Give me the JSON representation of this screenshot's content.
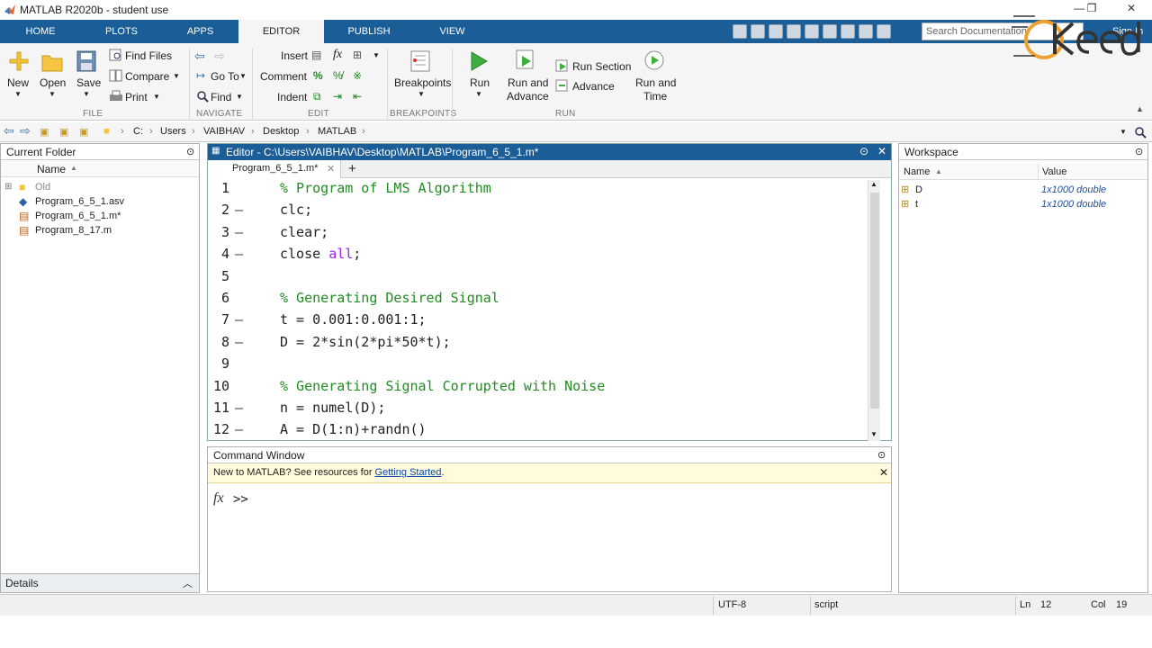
{
  "window": {
    "title": "MATLAB R2020b - student use"
  },
  "ribbon_tabs": [
    "HOME",
    "PLOTS",
    "APPS",
    "EDITOR",
    "PUBLISH",
    "VIEW"
  ],
  "search": {
    "placeholder": "Search Documentation"
  },
  "sign_in": "Sign In",
  "ribbon": {
    "file": {
      "new": "New",
      "open": "Open",
      "save": "Save",
      "find_files": "Find Files",
      "compare": "Compare",
      "print": "Print",
      "section": "FILE"
    },
    "navigate": {
      "go_to": "Go To",
      "find": "Find",
      "section": "NAVIGATE"
    },
    "edit": {
      "insert": "Insert",
      "comment": "Comment",
      "indent": "Indent",
      "section": "EDIT"
    },
    "breakpoints": {
      "label": "Breakpoints",
      "section": "BREAKPOINTS"
    },
    "run": {
      "run": "Run",
      "run_and_advance_1": "Run and",
      "run_and_advance_2": "Advance",
      "run_section": "Run Section",
      "advance": "Advance",
      "run_and_time_1": "Run and",
      "run_and_time_2": "Time",
      "section": "RUN"
    }
  },
  "address": {
    "crumbs": [
      "C:",
      "Users",
      "VAIBHAV",
      "Desktop",
      "MATLAB"
    ]
  },
  "current_folder": {
    "title": "Current Folder",
    "column": "Name",
    "items": [
      "Old",
      "Program_6_5_1.asv",
      "Program_6_5_1.m*",
      "Program_8_17.m"
    ]
  },
  "editor": {
    "title": "Editor - C:\\Users\\VAIBHAV\\Desktop\\MATLAB\\Program_6_5_1.m*",
    "tab": "Program_6_5_1.m*",
    "lines": [
      {
        "n": "1",
        "dash": "",
        "segs": [
          [
            "cmt",
            "% Program of LMS Algorithm"
          ]
        ]
      },
      {
        "n": "2",
        "dash": "—",
        "segs": [
          [
            "",
            "clc;"
          ]
        ]
      },
      {
        "n": "3",
        "dash": "—",
        "segs": [
          [
            "",
            "clear;"
          ]
        ]
      },
      {
        "n": "4",
        "dash": "—",
        "segs": [
          [
            "",
            "close "
          ],
          [
            "kw",
            "all"
          ],
          [
            "",
            ";"
          ]
        ]
      },
      {
        "n": "5",
        "dash": "",
        "segs": [
          [
            "",
            ""
          ]
        ]
      },
      {
        "n": "6",
        "dash": "",
        "segs": [
          [
            "cmt",
            "% Generating Desired Signal"
          ]
        ]
      },
      {
        "n": "7",
        "dash": "—",
        "segs": [
          [
            "",
            "t = 0.001:0.001:1;"
          ]
        ]
      },
      {
        "n": "8",
        "dash": "—",
        "segs": [
          [
            "",
            "D = 2*sin(2*pi*50*t);"
          ]
        ]
      },
      {
        "n": "9",
        "dash": "",
        "segs": [
          [
            "",
            ""
          ]
        ]
      },
      {
        "n": "10",
        "dash": "",
        "segs": [
          [
            "cmt",
            "% Generating Signal Corrupted with Noise"
          ]
        ]
      },
      {
        "n": "11",
        "dash": "—",
        "segs": [
          [
            "",
            "n = numel(D);"
          ]
        ]
      },
      {
        "n": "12",
        "dash": "—",
        "segs": [
          [
            "",
            "A = D(1:n)+randn()"
          ]
        ]
      }
    ]
  },
  "command_window": {
    "title": "Command Window",
    "notice": "New to MATLAB? See resources for ",
    "notice_link": "Getting Started",
    "notice_end": ".",
    "prompt": ">>",
    "fx": "fx"
  },
  "workspace": {
    "title": "Workspace",
    "col_name": "Name",
    "col_value": "Value",
    "vars": [
      {
        "name": "D",
        "value": "1x1000 double"
      },
      {
        "name": "t",
        "value": "1x1000 double"
      }
    ]
  },
  "details": "Details",
  "status": {
    "encoding": "UTF-8",
    "type": "script",
    "ln_label": "Ln",
    "ln": "12",
    "col_label": "Col",
    "col": "19"
  },
  "colors": {
    "tabstrip": "#1b5d96",
    "comment": "#228b22",
    "keyword": "#a020f0"
  }
}
